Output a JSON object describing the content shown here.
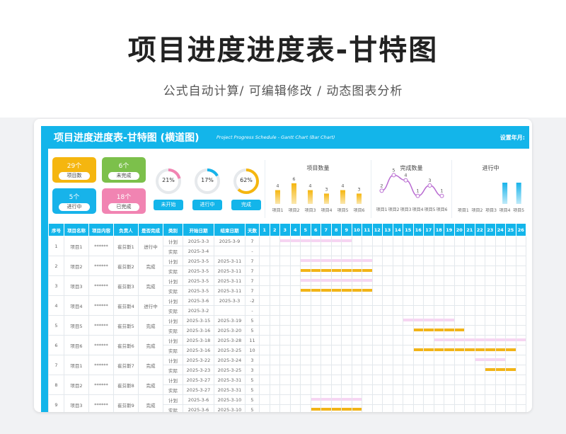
{
  "page": {
    "title": "项目进度进度表-甘特图",
    "subtitle": "公式自动计算/ 可编辑修改 / 动态图表分析"
  },
  "sheet": {
    "title": "项目进度进度表-甘特图 (横道图)",
    "title_en": "Project Progress Schedule - Gantt Chart (Bar Chart)",
    "year_month_label": "设置年月:"
  },
  "kpis": [
    {
      "value": "29个",
      "label": "项目数",
      "color": "#f5b60f"
    },
    {
      "value": "6个",
      "label": "未完成",
      "color": "#7cc04b"
    },
    {
      "value": "5个",
      "label": "进行中",
      "color": "#17b3ea"
    },
    {
      "value": "18个",
      "label": "已完成",
      "color": "#f184b2"
    }
  ],
  "rings": [
    {
      "pct_text": "21%",
      "value": 0.21,
      "color": "#f184b2",
      "button": "未开始"
    },
    {
      "pct_text": "17%",
      "value": 0.17,
      "color": "#17b3ea",
      "button": "进行中"
    },
    {
      "pct_text": "62%",
      "value": 0.62,
      "color": "#f5b60f",
      "button": "完成"
    }
  ],
  "chart_data": [
    {
      "type": "bar",
      "title": "项目数量",
      "categories": [
        "项目1",
        "项目2",
        "项目3",
        "项目4",
        "项目5",
        "项目6"
      ],
      "values": [
        4,
        6,
        4,
        3,
        4,
        3
      ],
      "ylim": [
        0,
        7
      ]
    },
    {
      "type": "line",
      "title": "完成数量",
      "categories": [
        "项目1",
        "项目2",
        "项目3",
        "项目4",
        "项目5",
        "项目6"
      ],
      "values": [
        2,
        5,
        4,
        1,
        3,
        1
      ],
      "ylim": [
        0,
        6
      ]
    },
    {
      "type": "bar",
      "title": "进行中",
      "categories": [
        "项目1",
        "项目2",
        "项目3",
        "项目4",
        "项目5"
      ],
      "values": [
        0,
        0,
        0,
        1,
        1
      ],
      "ylim": [
        0,
        1.2
      ]
    }
  ],
  "table": {
    "headers": [
      "序号",
      "项目名称",
      "项目内容",
      "负责人",
      "是否完成",
      "类别",
      "开始日期",
      "结束日期",
      "天数"
    ],
    "days": [
      "1",
      "2",
      "3",
      "4",
      "5",
      "6",
      "7",
      "8",
      "9",
      "10",
      "11",
      "12",
      "13",
      "14",
      "15",
      "16",
      "17",
      "18",
      "19",
      "20",
      "21",
      "22",
      "23",
      "24",
      "25",
      "26"
    ],
    "groups": [
      {
        "no": "1",
        "name": "项目1",
        "content": "******",
        "owner": "崔芬斯1",
        "status": "进行中",
        "rows": [
          {
            "type": "计划",
            "start": "2025-3-3",
            "end": "2025-3-9",
            "days": "7",
            "bar": [
              3,
              9
            ]
          },
          {
            "type": "实际",
            "start": "2025-3-4",
            "end": "",
            "days": "-",
            "bar": null
          }
        ]
      },
      {
        "no": "2",
        "name": "项目2",
        "content": "******",
        "owner": "崔芬斯2",
        "status": "完成",
        "rows": [
          {
            "type": "计划",
            "start": "2025-3-5",
            "end": "2025-3-11",
            "days": "7",
            "bar": [
              5,
              11
            ]
          },
          {
            "type": "实际",
            "start": "2025-3-5",
            "end": "2025-3-11",
            "days": "7",
            "bar": [
              5,
              11
            ]
          }
        ]
      },
      {
        "no": "3",
        "name": "项目3",
        "content": "******",
        "owner": "崔芬斯3",
        "status": "完成",
        "rows": [
          {
            "type": "计划",
            "start": "2025-3-5",
            "end": "2025-3-11",
            "days": "7",
            "bar": [
              5,
              11
            ]
          },
          {
            "type": "实际",
            "start": "2025-3-5",
            "end": "2025-3-11",
            "days": "7",
            "bar": [
              5,
              11
            ]
          }
        ]
      },
      {
        "no": "4",
        "name": "项目4",
        "content": "******",
        "owner": "崔芬斯4",
        "status": "进行中",
        "rows": [
          {
            "type": "计划",
            "start": "2025-3-6",
            "end": "2025-3-3",
            "days": "-2",
            "bar": null
          },
          {
            "type": "实际",
            "start": "2025-3-2",
            "end": "",
            "days": "-",
            "bar": null
          }
        ]
      },
      {
        "no": "5",
        "name": "项目5",
        "content": "******",
        "owner": "崔芬斯5",
        "status": "完成",
        "rows": [
          {
            "type": "计划",
            "start": "2025-3-15",
            "end": "2025-3-19",
            "days": "5",
            "bar": [
              15,
              19
            ]
          },
          {
            "type": "实际",
            "start": "2025-3-16",
            "end": "2025-3-20",
            "days": "5",
            "bar": [
              16,
              20
            ]
          }
        ]
      },
      {
        "no": "6",
        "name": "项目6",
        "content": "******",
        "owner": "崔芬斯6",
        "status": "完成",
        "rows": [
          {
            "type": "计划",
            "start": "2025-3-18",
            "end": "2025-3-28",
            "days": "11",
            "bar": [
              18,
              26
            ]
          },
          {
            "type": "实际",
            "start": "2025-3-16",
            "end": "2025-3-25",
            "days": "10",
            "bar": [
              16,
              25
            ]
          }
        ]
      },
      {
        "no": "7",
        "name": "项目1",
        "content": "******",
        "owner": "崔芬斯7",
        "status": "完成",
        "rows": [
          {
            "type": "计划",
            "start": "2025-3-22",
            "end": "2025-3-24",
            "days": "3",
            "bar": [
              22,
              24
            ]
          },
          {
            "type": "实际",
            "start": "2025-3-23",
            "end": "2025-3-25",
            "days": "3",
            "bar": [
              23,
              25
            ]
          }
        ]
      },
      {
        "no": "8",
        "name": "项目2",
        "content": "******",
        "owner": "崔芬斯8",
        "status": "完成",
        "rows": [
          {
            "type": "计划",
            "start": "2025-3-27",
            "end": "2025-3-31",
            "days": "5",
            "bar": [
              27,
              31
            ]
          },
          {
            "type": "实际",
            "start": "2025-3-27",
            "end": "2025-3-31",
            "days": "5",
            "bar": [
              27,
              31
            ]
          }
        ]
      },
      {
        "no": "9",
        "name": "项目3",
        "content": "******",
        "owner": "崔芬斯9",
        "status": "完成",
        "rows": [
          {
            "type": "计划",
            "start": "2025-3-6",
            "end": "2025-3-10",
            "days": "5",
            "bar": [
              6,
              10
            ]
          },
          {
            "type": "实际",
            "start": "2025-3-6",
            "end": "2025-3-10",
            "days": "5",
            "bar": [
              6,
              10
            ]
          }
        ]
      }
    ]
  }
}
